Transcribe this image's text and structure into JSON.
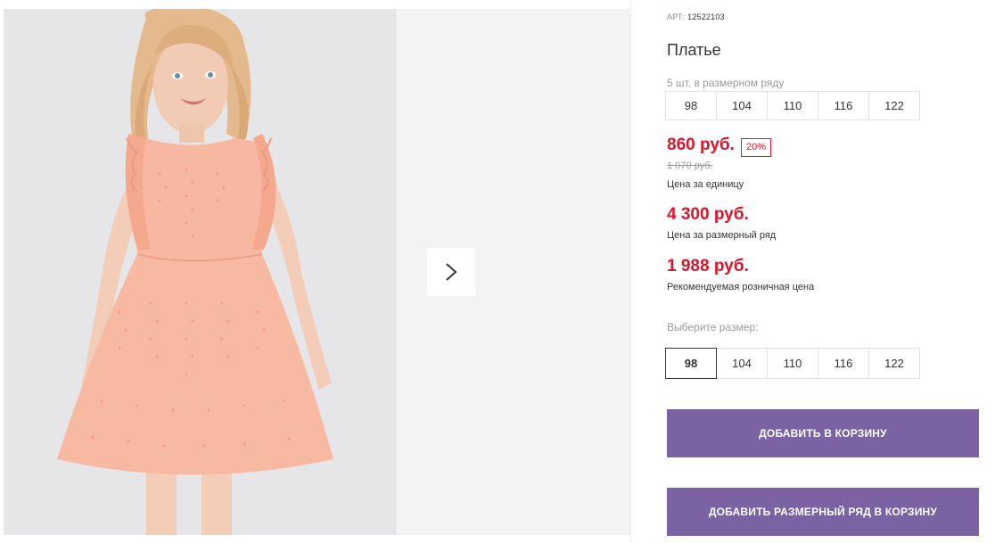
{
  "product": {
    "article_label": "АРТ:",
    "article_number": "12522103",
    "title": "Платье",
    "pack_quantity": "5 шт. в размерном ряду",
    "pack_sizes": [
      "98",
      "104",
      "110",
      "116",
      "122"
    ]
  },
  "pricing": {
    "unit_price": "860 руб.",
    "discount": "20%",
    "old_price": "1 070 руб.",
    "unit_caption": "Цена за единицу",
    "row_price": "4 300 руб.",
    "row_caption": "Цена за размерный ряд",
    "retail_price": "1 988 руб.",
    "retail_caption": "Рекомендуемая розничная цена"
  },
  "size_picker": {
    "label": "Выберите размер:",
    "options": [
      "98",
      "104",
      "110",
      "116",
      "122"
    ],
    "selected": "98"
  },
  "actions": {
    "add_to_cart": "ДОБАВИТЬ В КОРЗИНУ",
    "add_row_to_cart": "ДОБАВИТЬ РАЗМЕРНЫЙ РЯД В КОРЗИНУ"
  },
  "colors": {
    "price_red": "#d9162c",
    "button_purple": "#7a62a3",
    "dress_peach": "#f5b19a"
  },
  "gallery": {
    "image_subject": "girl-in-peach-dress-photo",
    "next_icon": "chevron-right-icon"
  }
}
